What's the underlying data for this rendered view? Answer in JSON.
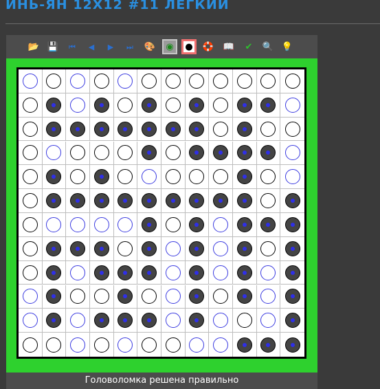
{
  "title": "ИНЬ-ЯН 12Х12 #11 ЛЕГКИЙ",
  "status": "Головоломка решена правильно",
  "colors": {
    "accent": "#2a8fe0",
    "solved_border": "#2ed12e",
    "given_ring": "#3a3ae0",
    "black_stone": "#444444"
  },
  "toolbar": [
    {
      "name": "open-icon",
      "glyph": "📂",
      "state": ""
    },
    {
      "name": "save-icon",
      "glyph": "💾",
      "state": ""
    },
    {
      "name": "first-icon",
      "glyph": "⏮",
      "state": ""
    },
    {
      "name": "prev-icon",
      "glyph": "◀",
      "state": ""
    },
    {
      "name": "next-icon",
      "glyph": "▶",
      "state": ""
    },
    {
      "name": "last-icon",
      "glyph": "⏭",
      "state": ""
    },
    {
      "name": "palette-icon",
      "glyph": "🎨",
      "state": ""
    },
    {
      "name": "white-stone-tool-icon",
      "glyph": "◉",
      "state": "sel-gray"
    },
    {
      "name": "black-stone-tool-icon",
      "glyph": "●",
      "state": "sel-red"
    },
    {
      "name": "help-lifebuoy-icon",
      "glyph": "🛟",
      "state": ""
    },
    {
      "name": "rules-book-icon",
      "glyph": "📖",
      "state": ""
    },
    {
      "name": "check-icon",
      "glyph": "✔",
      "state": ""
    },
    {
      "name": "zoom-icon",
      "glyph": "🔍",
      "state": ""
    },
    {
      "name": "hint-icon",
      "glyph": "💡",
      "state": ""
    }
  ],
  "legend": {
    "W": "white given",
    "w": "white placed",
    "B": "black given",
    "b": "black placed"
  },
  "grid": [
    "WwWwWwwwwwww",
    "wbWbwbwbwbbW",
    "wbbbbbbbwbww",
    "wWwwwbwbbbbW",
    "wbwbwWwwwbwW",
    "wbbbbbbbbbwb",
    "wWWWWbwbWbbb",
    "wbbbwbWbWbwb",
    "wbWbbbWbWbWb",
    "WbwwbwWbwbWb",
    "WbWbbbWbWwWb",
    "wwWwWwwWWbbb"
  ]
}
